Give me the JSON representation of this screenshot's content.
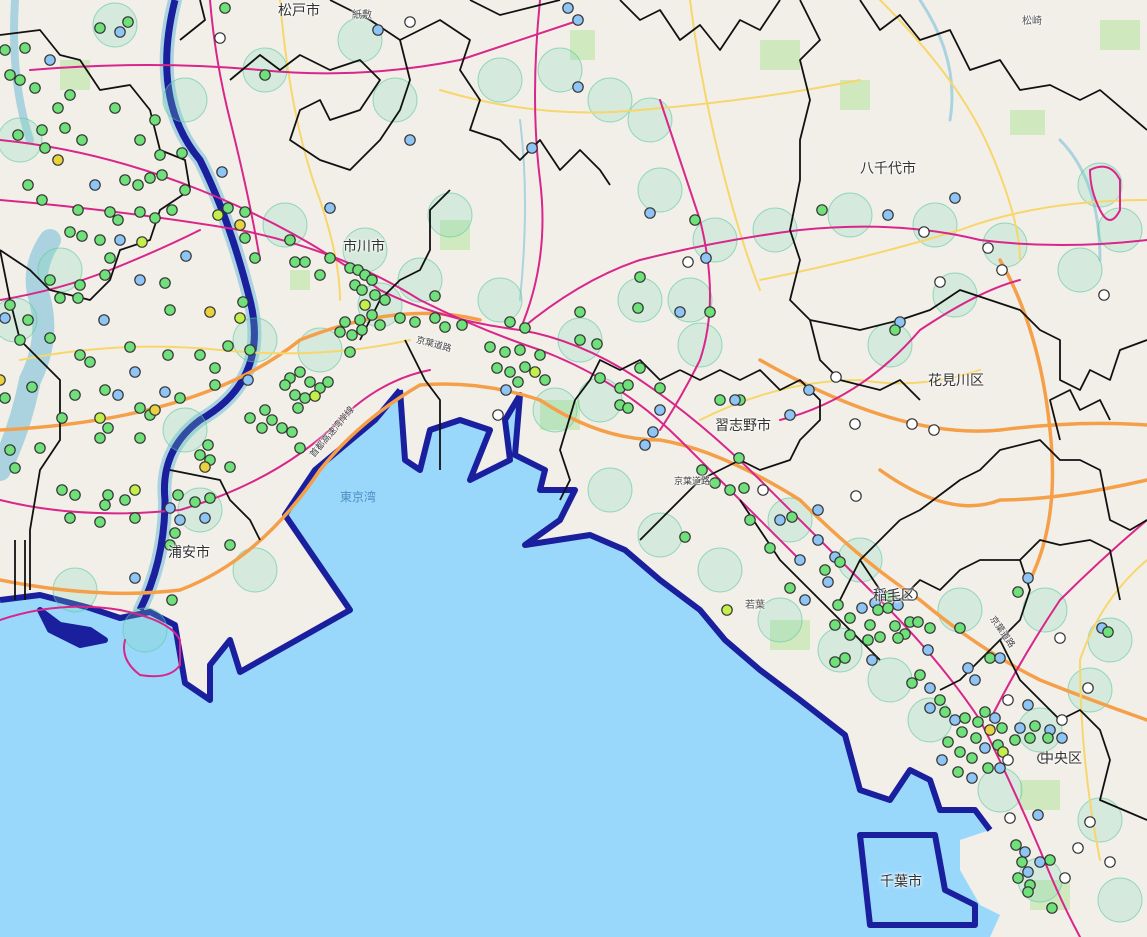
{
  "map": {
    "colors": {
      "land": "#f2efe9",
      "sea": "#99d8fb",
      "river": "#aad3df",
      "park": "#cde8b9",
      "coast_boundary": "#1a1f9e",
      "admin_boundary": "#111111",
      "rail": "#d9268a",
      "highway": "#f5a049",
      "road": "#f7d76b",
      "buffer": "#7fd8b8",
      "marker_blue": "#8ec5f5",
      "marker_green": "#6fe07a",
      "marker_lime": "#c4ee4a",
      "marker_yellow": "#e8d23f",
      "marker_white": "#ffffff",
      "marker_stroke": "#333333"
    },
    "place_labels": [
      {
        "id": "matsudo",
        "text": "松戸市"
      },
      {
        "id": "ichikawa",
        "text": "市川市"
      },
      {
        "id": "yachiyo",
        "text": "八千代市"
      },
      {
        "id": "hanamigawa",
        "text": "花見川区"
      },
      {
        "id": "narashino",
        "text": "習志野市"
      },
      {
        "id": "urayasu",
        "text": "浦安市"
      },
      {
        "id": "inage",
        "text": "稲毛区"
      },
      {
        "id": "chuo",
        "text": "中央区"
      },
      {
        "id": "chiba",
        "text": "千葉市"
      }
    ],
    "small_labels": [
      {
        "id": "shinkoiwa",
        "text": "紙敷"
      },
      {
        "id": "matsuzaki",
        "text": "松崎"
      },
      {
        "id": "wakaba",
        "text": "若葉"
      }
    ],
    "road_labels": [
      {
        "id": "keiyo-road-1",
        "text": "京葉道路"
      },
      {
        "id": "keiyo-road-2",
        "text": "京葉道路"
      },
      {
        "id": "keiyo-road-3",
        "text": "京葉道路"
      },
      {
        "id": "wangan",
        "text": "首都高速湾岸線"
      }
    ],
    "water_labels": [
      {
        "id": "tokyo-bay",
        "text": "東京湾"
      }
    ]
  }
}
